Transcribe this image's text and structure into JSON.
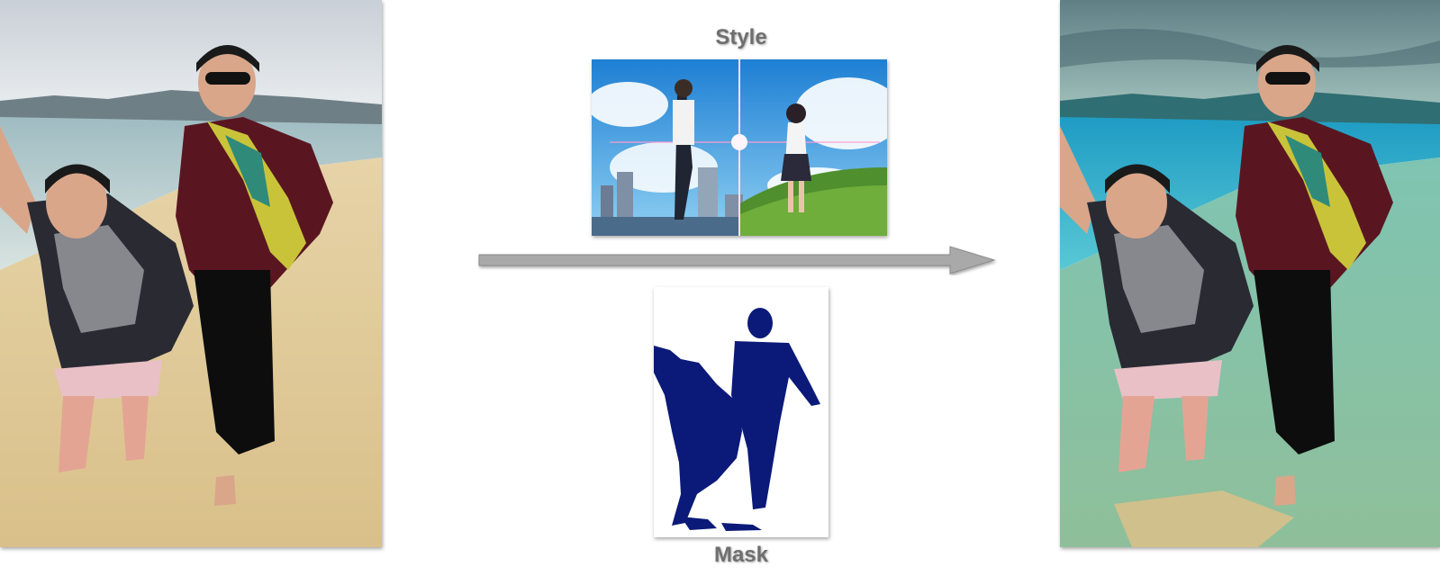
{
  "labels": {
    "style": "Style",
    "mask": "Mask"
  },
  "colors": {
    "mask_fill": "#0b1a78",
    "arrow_fill": "#a9a9a9",
    "label_text": "#6f6f6f"
  }
}
